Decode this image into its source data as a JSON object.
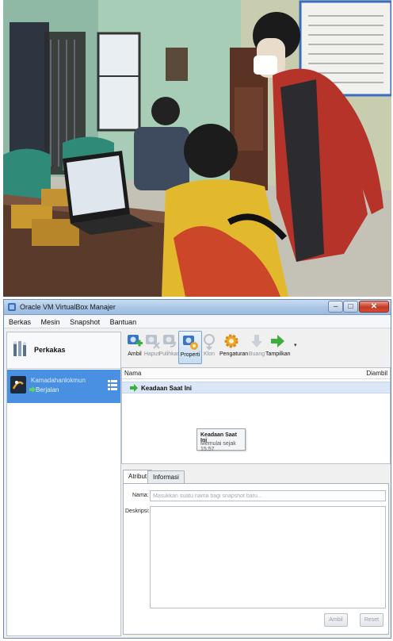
{
  "window": {
    "title": "Oracle VM VirtualBox Manajer",
    "minimize": "–",
    "maximize": "□",
    "close": "✕"
  },
  "menu": [
    "Berkas",
    "Mesin",
    "Snapshot",
    "Bantuan"
  ],
  "sidebar": {
    "tools_label": "Perkakas",
    "vm": {
      "name": "Kamadahanlokmun",
      "state": "Berjalan"
    }
  },
  "toolbar": {
    "buttons": [
      {
        "label": "Ambil",
        "icon": "take-snapshot-icon",
        "enabled": true
      },
      {
        "label": "Hapus",
        "icon": "delete-snapshot-icon",
        "enabled": false
      },
      {
        "label": "Pulihkan",
        "icon": "restore-snapshot-icon",
        "enabled": false
      },
      {
        "label": "Properti",
        "icon": "properties-icon",
        "enabled": true,
        "active": true
      },
      {
        "label": "Klon",
        "icon": "clone-icon",
        "enabled": false
      },
      {
        "label": "Pengaturan",
        "icon": "settings-gear-icon",
        "enabled": true
      },
      {
        "label": "Buang",
        "icon": "discard-icon",
        "enabled": false
      },
      {
        "label": "Tampilkan",
        "icon": "show-arrow-icon",
        "enabled": true
      }
    ],
    "more": "▾"
  },
  "snapshots": {
    "col_name": "Nama",
    "col_taken": "Diambil",
    "current_state": "Keadaan Saat Ini"
  },
  "tooltip": {
    "title": "Keadaan Saat Ini",
    "detail": "Memulai sejak 15:57"
  },
  "details": {
    "tabs": [
      "Atribut",
      "Informasi"
    ],
    "name_label": "Nama:",
    "name_placeholder": "Masukkan suatu nama bagi snapshot baru...",
    "desc_label": "Deskripsi:",
    "apply_label": "Ambil",
    "reset_label": "Reset"
  },
  "colors": {
    "selection": "#4a90e2",
    "accent_green": "#3cae3c",
    "titlebar": "#a7c4e6"
  }
}
